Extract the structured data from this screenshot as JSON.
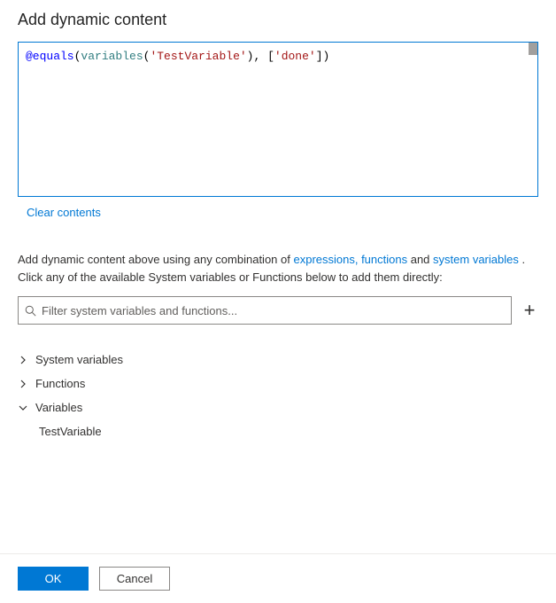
{
  "title": "Add dynamic content",
  "expression": {
    "tokens": [
      {
        "cls": "tok-blue",
        "t": "@equals"
      },
      {
        "cls": "tok-black",
        "t": "("
      },
      {
        "cls": "tok-teal",
        "t": "variables"
      },
      {
        "cls": "tok-black",
        "t": "("
      },
      {
        "cls": "tok-red",
        "t": "'TestVariable'"
      },
      {
        "cls": "tok-black",
        "t": "), ["
      },
      {
        "cls": "tok-red",
        "t": "'done'"
      },
      {
        "cls": "tok-black",
        "t": "])"
      }
    ]
  },
  "clear_link": "Clear contents",
  "help": {
    "prefix": "Add dynamic content above using any combination of ",
    "link1": "expressions, functions",
    "mid": " and ",
    "link2": "system variables",
    "suffix": " . Click any of the available System variables or Functions below to add them directly:"
  },
  "filter": {
    "placeholder": "Filter system variables and functions..."
  },
  "sections": {
    "system_variables": {
      "label": "System variables",
      "expanded": false
    },
    "functions": {
      "label": "Functions",
      "expanded": false
    },
    "variables": {
      "label": "Variables",
      "expanded": true,
      "items": [
        "TestVariable"
      ]
    }
  },
  "buttons": {
    "ok": "OK",
    "cancel": "Cancel"
  }
}
